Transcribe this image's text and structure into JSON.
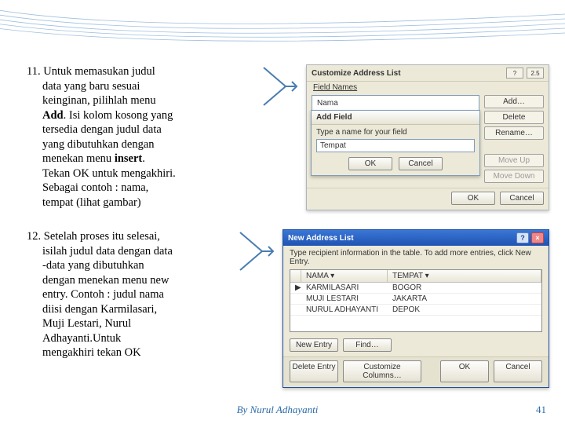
{
  "step11": {
    "num": "11.",
    "text_parts": [
      "Untuk memasukan judul",
      "data yang baru sesuai",
      "keinginan, pilihlah menu"
    ],
    "bold1": "Add",
    "text_parts2": [
      ". Isi kolom kosong yang",
      "tersedia dengan judul data",
      "yang dibutuhkan dengan",
      "menekan menu "
    ],
    "bold2": "insert",
    "text_parts3": [
      ".",
      "Tekan OK untuk mengakhiri.",
      "Sebagai contoh : nama,",
      "tempat (lihat gambar)"
    ]
  },
  "step12": {
    "num": "12.",
    "lines": [
      "Setelah proses itu selesai,",
      "isilah judul data dengan data",
      "-data yang dibutuhkan",
      "dengan menekan menu new",
      "entry. Contoh : judul nama",
      "diisi dengan Karmilasari,",
      "Muji Lestari, Nurul",
      "Adhayanti.Untuk",
      "mengakhiri tekan OK"
    ]
  },
  "dlg1": {
    "title": "Customize Address List",
    "q_btn": "?",
    "x_btn": "2.5",
    "field_label": "Field Names",
    "list_item": "Nama",
    "add": "Add…",
    "delete": "Delete",
    "rename": "Rename…",
    "moveup": "Move Up",
    "movedown": "Move Down",
    "ok": "OK",
    "cancel": "Cancel",
    "sub": {
      "title": "Add Field",
      "prompt": "Type a name for your field",
      "value": "Tempat",
      "ok": "OK",
      "cancel": "Cancel"
    }
  },
  "dlg2": {
    "title": "New Address List",
    "hint": "Type recipient information in the table. To add more entries, click New Entry.",
    "cols": {
      "c1": "NAMA  ▾",
      "c2": "TEMPAT  ▾"
    },
    "rows": [
      {
        "c1": "KARMILASARI",
        "c2": "BOGOR"
      },
      {
        "c1": "MUJI LESTARI",
        "c2": "JAKARTA"
      },
      {
        "c1": "NURUL ADHAYANTI",
        "c2": "DEPOK"
      }
    ],
    "new_entry": "New Entry",
    "find": "Find…",
    "delete_entry": "Delete Entry",
    "customize": "Customize Columns…",
    "ok": "OK",
    "cancel": "Cancel"
  },
  "footer": {
    "by": "By Nurul Adhayanti",
    "page": "41"
  }
}
